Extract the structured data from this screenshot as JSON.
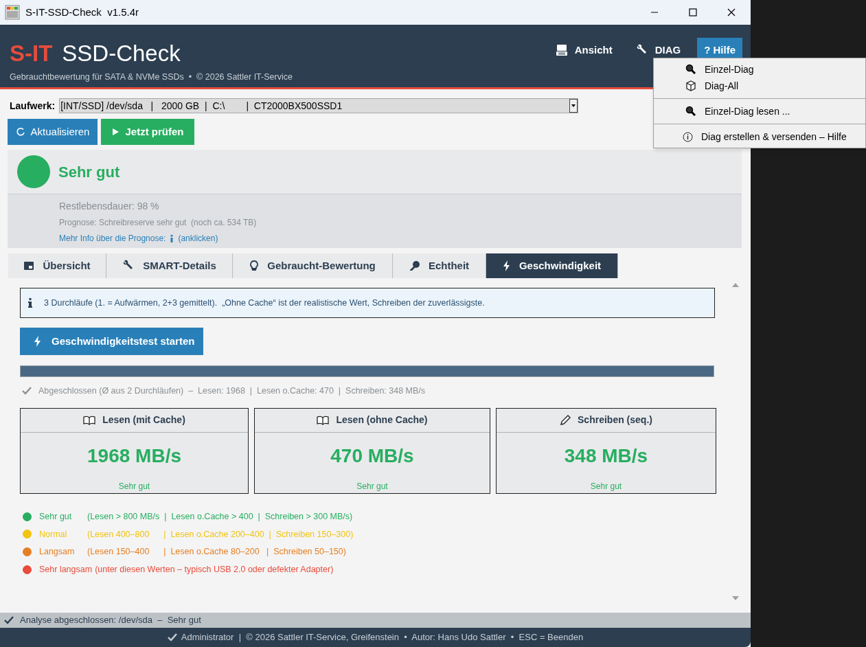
{
  "window": {
    "title": "S-IT-SSD-Check  v1.5.4r"
  },
  "header": {
    "brand": "S-IT",
    "product": "SSD-Check",
    "subtitle": "Gebrauchtbewertung für SATA & NVMe SSDs  •  © 2026 Sattler IT-Service",
    "menu": [
      {
        "label": "Ansicht",
        "selected": false
      },
      {
        "label": "DIAG",
        "selected": false
      },
      {
        "label": "? Hilfe",
        "selected": true
      }
    ]
  },
  "dropdown": {
    "groups": [
      [
        {
          "label": "Einzel-Diag"
        },
        {
          "label": "Diag-All"
        }
      ],
      [
        {
          "label": "Einzel-Diag lesen ..."
        }
      ],
      [
        {
          "label": "Diag erstellen & versenden – Hilfe"
        }
      ]
    ]
  },
  "drive": {
    "label": "Laufwerk:",
    "value": "[INT/SSD] /dev/sda   |   2000 GB  |  C:\\        |  CT2000BX500SSD1"
  },
  "buttons": [
    {
      "label": "Aktualisieren",
      "kind": "refresh"
    },
    {
      "label": "Jetzt prüfen",
      "kind": "run"
    }
  ],
  "status": {
    "title": "Sehr gut",
    "color": "#27ae60",
    "remaining": "Restlebensdauer: 98 %",
    "prognosis": "Prognose: Schreibreserve sehr gut  (noch ca. 534 TB)",
    "link": "Mehr Info über die Prognose:",
    "link_hint": "(anklicken)"
  },
  "tabs": [
    {
      "label": "Übersicht",
      "selected": false
    },
    {
      "label": "SMART-Details",
      "selected": false
    },
    {
      "label": "Gebraucht-Bewertung",
      "selected": false
    },
    {
      "label": "Echtheit",
      "selected": false
    },
    {
      "label": "Geschwindigkeit",
      "selected": true
    }
  ],
  "speed": {
    "info": "3 Durchläufe (1. = Aufwärmen, 2+3 gemittelt).  „Ohne Cache“ ist der realistische Wert, Schreiben der zuverlässigste.",
    "start_button": "Geschwindigkeitstest starten",
    "progress": {
      "level": 1
    },
    "result": "Abgeschlossen (Ø aus 2 Durchläufen)  –  Lesen: 1968  |  Lesen o.Cache: 470  |  Schreiben: 348 MB/s",
    "cards": [
      {
        "title": "Lesen (mit Cache)",
        "kind": "read",
        "value": "1968 MB/s",
        "rating": "Sehr gut"
      },
      {
        "title": "Lesen (ohne Cache)",
        "kind": "read",
        "value": "470 MB/s",
        "rating": "Sehr gut"
      },
      {
        "title": "Schreiben (seq.)",
        "kind": "write",
        "value": "348 MB/s",
        "rating": "Sehr gut"
      }
    ],
    "legend": [
      {
        "label": "Sehr gut",
        "range": "(Lesen > 800 MB/s  |  Lesen o.Cache > 400  |  Schreiben > 300 MB/s)",
        "color": "#27ae60"
      },
      {
        "label": "Normal",
        "range": "(Lesen 400–800      |  Lesen o.Cache 200–400  |  Schreiben 150–300)",
        "color": "#f1c40f"
      },
      {
        "label": "Langsam",
        "range": "(Lesen 150–400      |  Lesen o.Cache 80–200   |  Schreiben 50–150)",
        "color": "#e67e22"
      },
      {
        "label": "Sehr langsam",
        "range": "(unter diesen Werten – typisch USB 2.0 oder defekter Adapter)",
        "color": "#e74c3c"
      }
    ]
  },
  "status_bar": "Analyse abgeschlossen: /dev/sda  –  Sehr gut",
  "footer": "Administrator  |  © 2026 Sattler IT-Service, Greifenstein  •  Autor: Hans Udo Sattler  •  ESC = Beenden"
}
